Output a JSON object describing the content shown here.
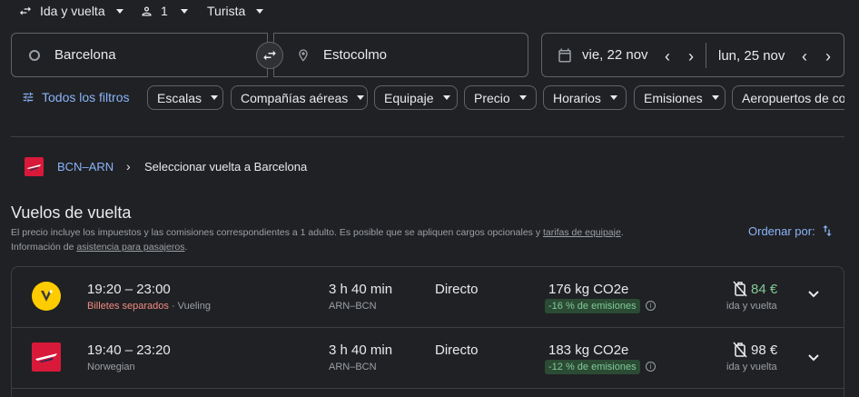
{
  "top_bar": {
    "trip_type": "Ida y vuelta",
    "passengers": "1",
    "cabin": "Turista"
  },
  "search": {
    "origin": "Barcelona",
    "destination": "Estocolmo",
    "depart_date": "vie, 22 nov",
    "return_date": "lun, 25 nov"
  },
  "filters": {
    "all_filters": "Todos los filtros",
    "chips": [
      "Escalas",
      "Compañías aéreas",
      "Equipaje",
      "Precio",
      "Horarios",
      "Emisiones",
      "Aeropuertos de co"
    ]
  },
  "breadcrumb": {
    "route": "BCN–ARN",
    "current": "Seleccionar vuelta a Barcelona"
  },
  "results": {
    "heading": "Vuelos de vuelta",
    "disclaimer_1": "El precio incluye los impuestos y las comisiones correspondientes a 1 adulto. Es posible que se apliquen cargos opcionales y ",
    "baggage_link": "tarifas de equipaje",
    "disclaimer_2": ".",
    "info_prefix": "Información de ",
    "assistance_link": "asistencia para pasajeros",
    "info_suffix": ".",
    "sort_label": "Ordenar por:"
  },
  "flights": [
    {
      "times": "19:20 – 23:00",
      "warning": "Billetes separados",
      "separator": " · ",
      "airline": "Vueling",
      "duration": "3 h 40 min",
      "route": "ARN–BCN",
      "stops": "Directo",
      "emissions": "176 kg CO2e",
      "emissions_badge": "-16 % de emisiones",
      "price": "84 €",
      "price_type": "ida y vuelta",
      "price_color": "#81c995"
    },
    {
      "times": "19:40 – 23:20",
      "airline": "Norwegian",
      "duration": "3 h 40 min",
      "route": "ARN–BCN",
      "stops": "Directo",
      "emissions": "183 kg CO2e",
      "emissions_badge": "-12 % de emisiones",
      "price": "98 €",
      "price_type": "ida y vuelta",
      "price_color": "#e8eaed"
    }
  ],
  "colors": {
    "background": "#202124",
    "accent_blue": "#8ab4f8",
    "warning_red": "#f28b82",
    "vueling_yellow": "#ffcc00",
    "norwegian_red": "#d81939"
  }
}
